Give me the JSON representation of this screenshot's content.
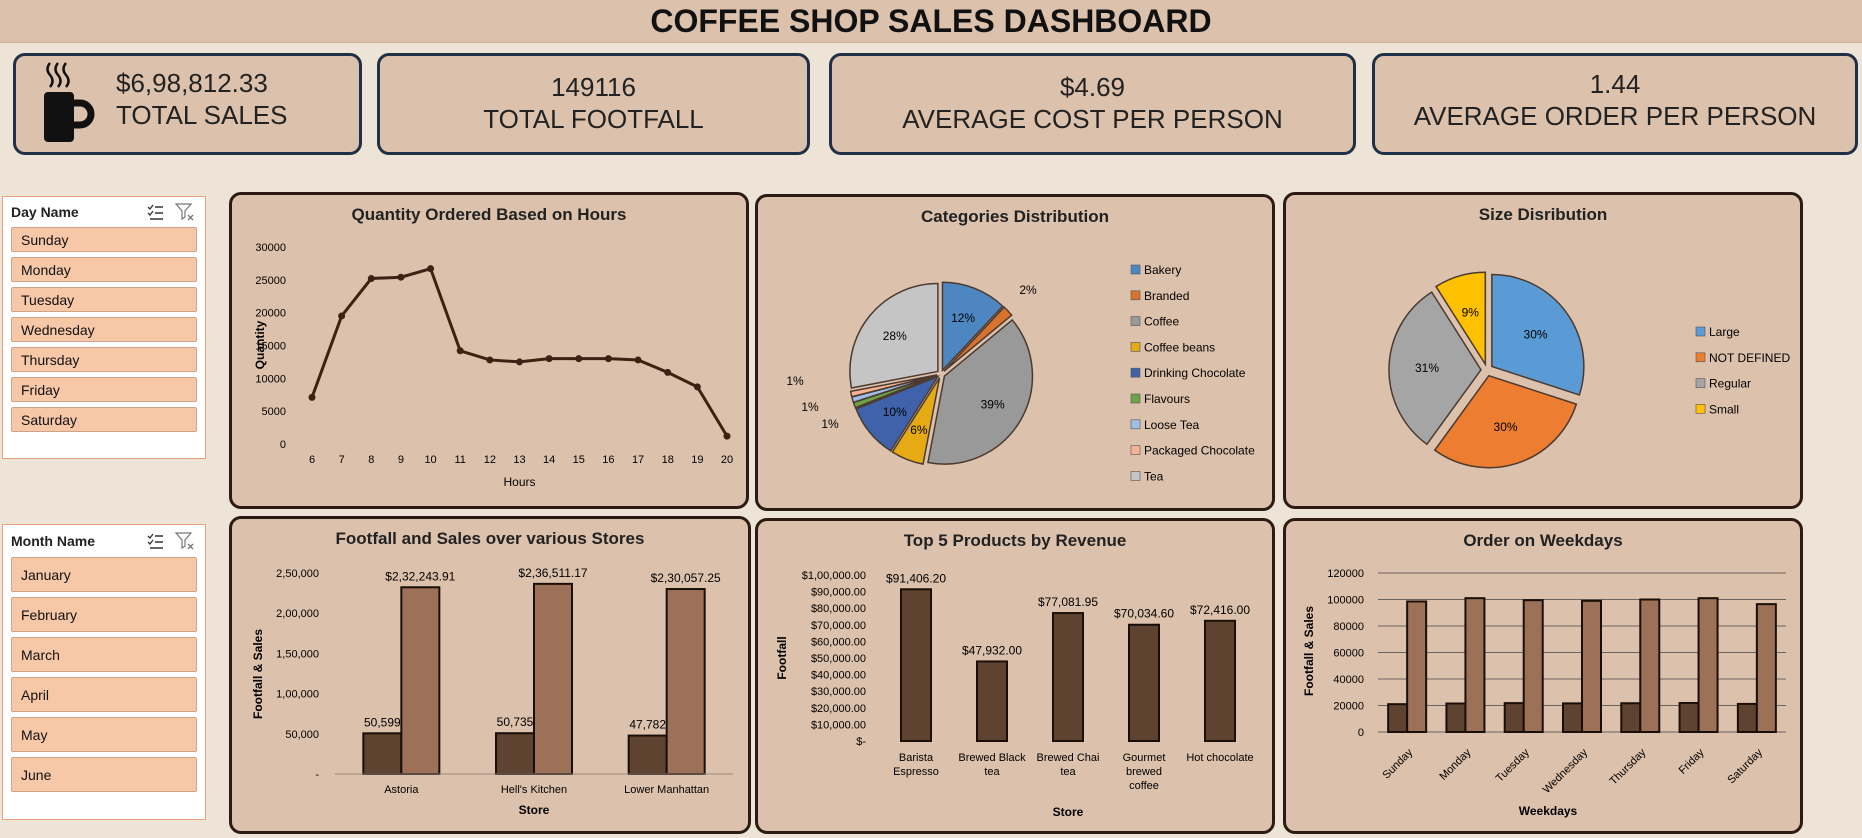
{
  "title": "COFFEE SHOP SALES DASHBOARD",
  "kpis": {
    "sales_value": "$6,98,812.33",
    "sales_label": "TOTAL SALES",
    "footfall_value": "149116",
    "footfall_label": "TOTAL FOOTFALL",
    "avg_cost_value": "$4.69",
    "avg_cost_label": "AVERAGE COST PER PERSON",
    "avg_order_value": "1.44",
    "avg_order_label": "AVERAGE ORDER PER PERSON"
  },
  "slicers": {
    "day": {
      "title": "Day Name",
      "items": [
        "Sunday",
        "Monday",
        "Tuesday",
        "Wednesday",
        "Thursday",
        "Friday",
        "Saturday"
      ]
    },
    "month": {
      "title": "Month Name",
      "items": [
        "January",
        "February",
        "March",
        "April",
        "May",
        "June"
      ]
    }
  },
  "colors": {
    "dark": "#5e4330",
    "light": "#9d7158",
    "line": "#3b2314"
  },
  "chart_data": [
    {
      "id": "hours",
      "type": "line",
      "title": "Quantity Ordered Based on Hours",
      "xlabel": "Hours",
      "ylabel": "Quantity",
      "x": [
        6,
        7,
        8,
        9,
        10,
        11,
        12,
        13,
        14,
        15,
        16,
        17,
        18,
        19,
        20
      ],
      "values": [
        7100,
        19500,
        25200,
        25400,
        26700,
        14200,
        12800,
        12500,
        13000,
        13000,
        13000,
        12800,
        10900,
        8700,
        1200
      ],
      "ylim": [
        0,
        30000
      ],
      "yticks": [
        "0",
        "5000",
        "10000",
        "15000",
        "20000",
        "25000",
        "30000"
      ]
    },
    {
      "id": "categories",
      "type": "pie",
      "title": "Categories Distribution",
      "labels": [
        "Bakery",
        "Branded",
        "Coffee",
        "Coffee beans",
        "Drinking Chocolate",
        "Flavours",
        "Loose Tea",
        "Packaged Chocolate",
        "Tea"
      ],
      "values": [
        12,
        2,
        39,
        6,
        10,
        1,
        1,
        1,
        28
      ],
      "value_labels": [
        "12%",
        "2%",
        "39%",
        "6%",
        "10%",
        "1%",
        "1%",
        "1%",
        "28%"
      ],
      "colors": [
        "#4e86c2",
        "#d9722c",
        "#999999",
        "#e6ab14",
        "#3f62aa",
        "#6ea248",
        "#9fc0e6",
        "#f4b393",
        "#c5c5c5"
      ]
    },
    {
      "id": "sizes",
      "type": "pie",
      "title": "Size Disribution",
      "labels": [
        "Large",
        "NOT DEFINED",
        "Regular",
        "Small"
      ],
      "values": [
        30,
        30,
        31,
        9
      ],
      "value_labels": [
        "30%",
        "30%",
        "31%",
        "9%"
      ],
      "colors": [
        "#5b9bd5",
        "#ed7d31",
        "#a5a5a5",
        "#ffc000"
      ]
    },
    {
      "id": "stores",
      "type": "bar",
      "title": "Footfall and Sales over various Stores",
      "xlabel": "Store",
      "ylabel": "Footfall & Sales",
      "categories": [
        "Astoria",
        "Hell's Kitchen",
        "Lower Manhattan"
      ],
      "series": [
        {
          "values": [
            50599,
            50735,
            47782
          ],
          "labels": [
            "50,599",
            "50,735",
            "47,782"
          ]
        },
        {
          "values": [
            232243.91,
            236511.17,
            230057.25
          ],
          "labels": [
            "$2,32,243.91",
            "$2,36,511.17",
            "$2,30,057.25"
          ]
        }
      ],
      "ylim": [
        0,
        250000
      ],
      "yticks": [
        "-",
        "50,000",
        "1,00,000",
        "1,50,000",
        "2,00,000",
        "2,50,000"
      ]
    },
    {
      "id": "products",
      "type": "bar",
      "title": "Top 5 Products by Revenue",
      "xlabel": "Store",
      "ylabel": "Footfall",
      "categories": [
        [
          "Barista",
          "Espresso"
        ],
        [
          "Brewed Black",
          "tea"
        ],
        [
          "Brewed Chai",
          "tea"
        ],
        [
          "Gourmet",
          "brewed",
          "coffee"
        ],
        [
          "Hot chocolate"
        ]
      ],
      "values": [
        91406.2,
        47932.0,
        77081.95,
        70034.6,
        72416.0
      ],
      "labels": [
        "$91,406.20",
        "$47,932.00",
        "$77,081.95",
        "$70,034.60",
        "$72,416.00"
      ],
      "ylim": [
        0,
        100000
      ],
      "yticks": [
        "$-",
        "$10,000.00",
        "$20,000.00",
        "$30,000.00",
        "$40,000.00",
        "$50,000.00",
        "$60,000.00",
        "$70,000.00",
        "$80,000.00",
        "$90,000.00",
        "$1,00,000.00"
      ]
    },
    {
      "id": "weekdays",
      "type": "bar",
      "title": "Order on Weekdays",
      "xlabel": "Weekdays",
      "ylabel": "Footfall & Sales",
      "categories": [
        "Sunday",
        "Monday",
        "Tuesday",
        "Wednesday",
        "Thursday",
        "Friday",
        "Saturday"
      ],
      "series": [
        {
          "values": [
            21000,
            21500,
            21800,
            21600,
            21700,
            21900,
            21200
          ]
        },
        {
          "values": [
            98500,
            101000,
            99500,
            99000,
            100000,
            101000,
            96500
          ]
        }
      ],
      "ylim": [
        0,
        120000
      ],
      "yticks": [
        "0",
        "20000",
        "40000",
        "60000",
        "80000",
        "100000",
        "120000"
      ]
    }
  ]
}
